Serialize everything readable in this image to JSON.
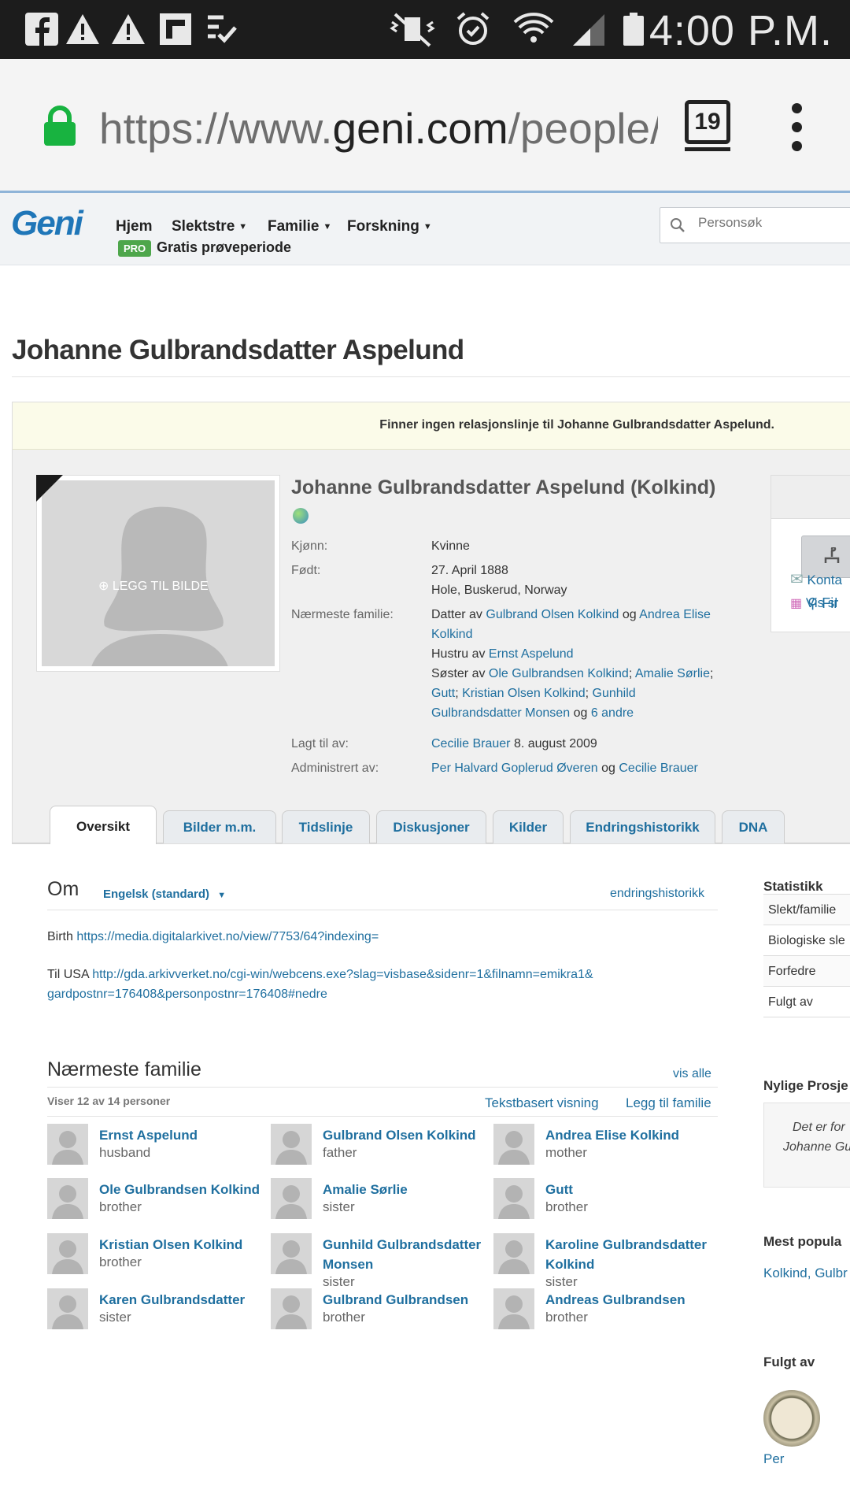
{
  "status_bar": {
    "time": "4:00 P.M."
  },
  "browser": {
    "url_prefix": "https://www.",
    "url_domain": "geni.com",
    "url_path": "/people/",
    "tab_count": "19"
  },
  "header": {
    "logo": "Geni",
    "nav": [
      "Hjem",
      "Slektstre",
      "Familie",
      "Forskning"
    ],
    "pro_badge": "PRO",
    "trial_label": "Gratis prøveperiode",
    "search_placeholder": "Personsøk"
  },
  "page_title": "Johanne Gulbrandsdatter Aspelund",
  "notice": "Finner ingen relasjonslinje til Johanne Gulbrandsdatter Aspelund.",
  "profile": {
    "add_photo": "LEGG TIL BILDE",
    "full_name": "Johanne Gulbrandsdatter Aspelund (Kolkind)",
    "gender_label": "Kjønn:",
    "gender": "Kvinne",
    "born_label": "Født:",
    "born_date": "27. April 1888",
    "born_place": "Hole, Buskerud, Norway",
    "family_label": "Nærmeste familie:",
    "daughter_of": "Datter av",
    "father": "Gulbrand Olsen Kolkind",
    "og1": "og",
    "mother": "Andrea Elise Kolkind",
    "wife_of": "Hustru av",
    "husband": "Ernst Aspelund",
    "sister_of": "Søster av",
    "siblings": [
      "Ole Gulbrandsen Kolkind",
      "Amalie Sørlie",
      "Gutt",
      "Kristian Olsen Kolkind",
      "Gunhild Gulbrandsdatter Monsen"
    ],
    "og2": "og",
    "others": "6 andre",
    "added_label": "Lagt til av:",
    "added_by": "Cecilie Brauer",
    "added_date": "8. august 2009",
    "admin_label": "Administrert av:",
    "admin_1": "Per Halvard Goplerud Øveren",
    "admin_og": "og",
    "admin_2": "Cecilie Brauer",
    "side_find": "Fir",
    "side_contact": "Konta",
    "side_show": "Vis sl"
  },
  "tabs": [
    "Oversikt",
    "Bilder m.m.",
    "Tidslinje",
    "Diskusjoner",
    "Kilder",
    "Endringshistorikk",
    "DNA"
  ],
  "about": {
    "title": "Om",
    "language": "Engelsk (standard)",
    "history_link": "endringshistorikk",
    "birth_label": "Birth",
    "birth_url": "https://media.digitalarkivet.no/view/7753/64?indexing=",
    "usa_label": "Til USA",
    "usa_url_1": "http://gda.arkivverket.no/cgi-win/webcens.exe?slag=visbase&sidenr=1&filnamn=emikra1&",
    "usa_url_2": "gardpostnr=176408&personpostnr=176408#nedre"
  },
  "family": {
    "title": "Nærmeste familie",
    "show_all": "vis alle",
    "count": "Viser 12 av 14 personer",
    "text_view": "Tekstbasert visning",
    "add_family": "Legg til familie",
    "members": [
      {
        "name": "Ernst Aspelund",
        "role": "husband"
      },
      {
        "name": "Gulbrand Olsen Kolkind",
        "role": "father"
      },
      {
        "name": "Andrea Elise Kolkind",
        "role": "mother"
      },
      {
        "name": "Ole Gulbrandsen Kolkind",
        "role": "brother"
      },
      {
        "name": "Amalie Sørlie",
        "role": "sister"
      },
      {
        "name": "Gutt",
        "role": "brother"
      },
      {
        "name": "Kristian Olsen Kolkind",
        "role": "brother"
      },
      {
        "name": "Gunhild Gulbrandsdatter Monsen",
        "role": "sister"
      },
      {
        "name": "Karoline Gulbrandsdatter Kolkind",
        "role": "sister"
      },
      {
        "name": "Karen Gulbrandsdatter",
        "role": "sister"
      },
      {
        "name": "Gulbrand Gulbrandsen",
        "role": "brother"
      },
      {
        "name": "Andreas Gulbrandsen",
        "role": "brother"
      }
    ]
  },
  "right_column": {
    "stats_title": "Statistikk",
    "stats_rows": [
      "Slekt/familie",
      "Biologiske sle",
      "Forfedre",
      "Fulgt av"
    ],
    "projects_title": "Nylige Prosje",
    "projects_text_1": "Det er for",
    "projects_text_2": "Johanne Gu",
    "popular_title": "Mest popula",
    "popular_text": "Kolkind, Gulbr",
    "followed_title": "Fulgt av",
    "follower": "Per"
  }
}
